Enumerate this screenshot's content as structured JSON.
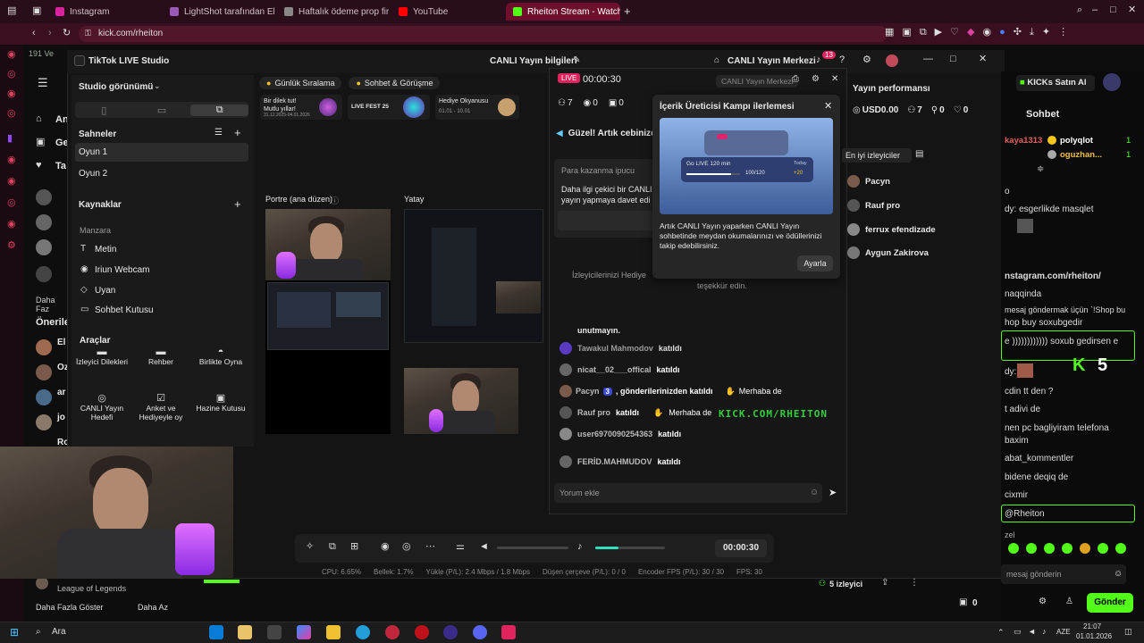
{
  "browser": {
    "tabs": [
      {
        "label": "Instagram",
        "color": "#d6249f"
      },
      {
        "label": "LightShot tarafından Ekran",
        "color": "#9b59b6"
      },
      {
        "label": "Haftalık ödeme prop firma",
        "color": "#aaaaaa"
      },
      {
        "label": "YouTube",
        "color": "#ff0000"
      },
      {
        "label": "Rheiton Stream - Watch L",
        "color": "#53fc18"
      }
    ],
    "url": "kick.com/rheiton"
  },
  "kick_left": {
    "viewers_top": "191 Ve",
    "nav": [
      "An",
      "Ge",
      "Ta"
    ],
    "more_follow": "Daha Faz",
    "recommended": "Önerile",
    "rec_names": [
      "El",
      "Oz",
      "ar",
      "jo",
      "Ro"
    ],
    "bottom_game": "League of Legends",
    "show_more": "Daha Fazla Göster",
    "show_less": "Daha Az"
  },
  "tiktok": {
    "app_title": "TikTok LIVE Studio",
    "live_info": "CANLI Yayın bilgileri",
    "live_center": "CANLI Yayın Merkezi",
    "notif_count": "13",
    "studio_view": "Studio görünümü",
    "scenes_title": "Sahneler",
    "scenes": [
      "Oyun 1",
      "Oyun 2"
    ],
    "sources_title": "Kaynaklar",
    "scene_group": "Manzara",
    "sources": [
      "Metin",
      "Iriun Webcam",
      "Uyan",
      "Sohbet Kutusu"
    ],
    "tools_title": "Araçlar",
    "tools": [
      {
        "label": "İzleyici Dilekleri"
      },
      {
        "label": "Rehber"
      },
      {
        "label": "Birlikte Oyna"
      },
      {
        "label": "CANLI Yayın Hedefi"
      },
      {
        "label": "Anket ve Hediyeyle oy"
      },
      {
        "label": "Hazine Kutusu"
      }
    ],
    "chips": [
      "Günlük Sıralama",
      "Sohbet & Görüşme"
    ],
    "banners": [
      {
        "text": "Bir dilek tut! Mutlu yıllar!",
        "sub": "31.12.2025-04.01.2026"
      },
      {
        "text": "LIVE FEST 25",
        "sub": ""
      },
      {
        "text": "Hediye Okyanusu",
        "sub": "01.01 - 10.01"
      }
    ],
    "portrait_label": "Portre (ana düzen)",
    "landscape_label": "Yatay",
    "bottom_timer": "00:00:30",
    "stats": {
      "cpu": "CPU: 6.65%",
      "mem": "Bellek: 1.7%",
      "upload": "Yükle (P/L): 2.4 Mbps / 1.8 Mbps",
      "dropped": "Düşen çerçeve (P/L): 0 / 0",
      "encoder": "Encoder FPS (P/L): 30 / 30",
      "fps": "FPS: 30"
    },
    "live_badge": "LIVE",
    "live_timer": "00:00:30",
    "live_counts": {
      "likes": "7",
      "viewers": "0",
      "gifts": "0"
    },
    "live_center_chip": "CANLI Yayın Merkezi",
    "good_msg": "Güzel! Artık cebinizde",
    "earn_tip_title": "Para kazanma ipucu",
    "earn_tip_text": "Daha ilgi çekici bir CANLI yayın yapmaya davet edi",
    "viewers_hidden": "İzleyicilerinizi Hediye",
    "thanks": "teşekkür edin.",
    "reminder": "unutmayın.",
    "chat": [
      {
        "name": "Tawakul Mahmodov",
        "action": "katıldı"
      },
      {
        "name": "nicat__02___offical",
        "action": "katıldı"
      },
      {
        "name": "Pacyn",
        "badge": "3",
        "action": ", gönderilerinizden katıldı",
        "wave": "Merhaba de"
      },
      {
        "name": "Rauf pro",
        "action": "katıldı",
        "wave": "Merhaba de"
      },
      {
        "name": "user6970090254363",
        "action": "katıldı"
      },
      {
        "name": "FERİD.MAHMUDOV",
        "action": "katıldı"
      }
    ],
    "overlay_url": "KICK.COM/RHEITON",
    "comment_placeholder": "Yorum ekle",
    "popup": {
      "title": "İçerik Üreticisi Kampı ilerlemesi",
      "card_title": "Go LIVE 120 min",
      "card_tag": "Today",
      "card_progress": "100/120",
      "card_reward": "+20",
      "progress": 0.83,
      "text": "Artık CANLI Yayın yaparken CANLI Yayın sohbetinde meydan okumalarınızı ve ödüllerinizi takip edebilirsiniz.",
      "button": "Ayarla"
    },
    "perf_title": "Yayın performansı",
    "perf_usd": "USD0.00",
    "perf_a": "7",
    "perf_b": "0",
    "perf_c": "0",
    "top_viewers_title": "En iyi izleyiciler",
    "top_viewers": [
      "Pacyn",
      "Rauf pro",
      "ferrux efendizade",
      "Aygun Zakirova"
    ]
  },
  "kick_chat": {
    "buy_kicks": "KICKs Satın Al",
    "title": "Sohbet",
    "pinned": [
      {
        "name": "kaya1313",
        "color": "#e05f5f"
      },
      {
        "name": "polyqlot",
        "color": "#ffffff"
      },
      {
        "name": "oguzhan...",
        "color": "#f0c040"
      }
    ],
    "pinned_counts": [
      "1",
      "1"
    ],
    "lines": [
      "o",
      "dy: esgerlikde masqlet",
      "",
      "nstagram.com/rheiton/",
      "naqqinda",
      "mesaj göndermak üçün `!Shop bu",
      "hop buy soxubgedir",
      "e )))))))))))) soxub gedirsen e",
      "dy:",
      "cdin tt den ?",
      "t adivi de",
      "nen pc bagliyiram telefona",
      "baxim",
      "abat_kommentler",
      "bidene deqiq de",
      "cixmir",
      "@Rheiton",
      "zel"
    ],
    "kick_count": "5",
    "input_placeholder": "mesaj gönderin",
    "send": "Gönder",
    "viewers_bar": "5 izleyici",
    "points": "0",
    "bottom_points": "0"
  },
  "taskbar": {
    "search": "Ara",
    "lang": "AZE",
    "time": "21:07",
    "date": "01.01.2026"
  }
}
